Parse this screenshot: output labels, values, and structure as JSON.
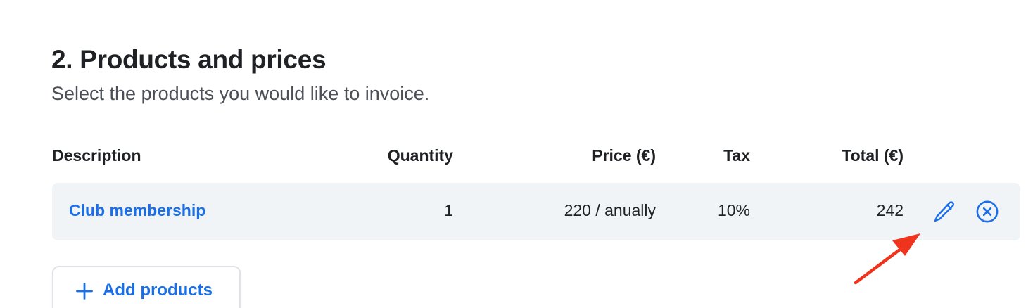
{
  "section": {
    "title": "2. Products and prices",
    "subtitle": "Select the products you would like to invoice."
  },
  "table": {
    "headers": {
      "description": "Description",
      "quantity": "Quantity",
      "price": "Price (€)",
      "tax": "Tax",
      "total": "Total (€)"
    },
    "rows": [
      {
        "description": "Club membership",
        "quantity": "1",
        "price": "220 / anually",
        "tax": "10%",
        "total": "242",
        "actions": [
          "pencil-icon",
          "close-circle-icon"
        ]
      }
    ]
  },
  "add_button": {
    "label": "Add products",
    "icon": "plus-icon"
  },
  "annotation": {
    "icon": "red-arrow-pointer",
    "color": "#f0331d"
  },
  "colors": {
    "accent": "#1a6fe8",
    "row_background": "#f1f4f6",
    "text_primary": "#1f2124",
    "text_secondary": "#4b4f57",
    "button_border": "#dfe3e8"
  }
}
